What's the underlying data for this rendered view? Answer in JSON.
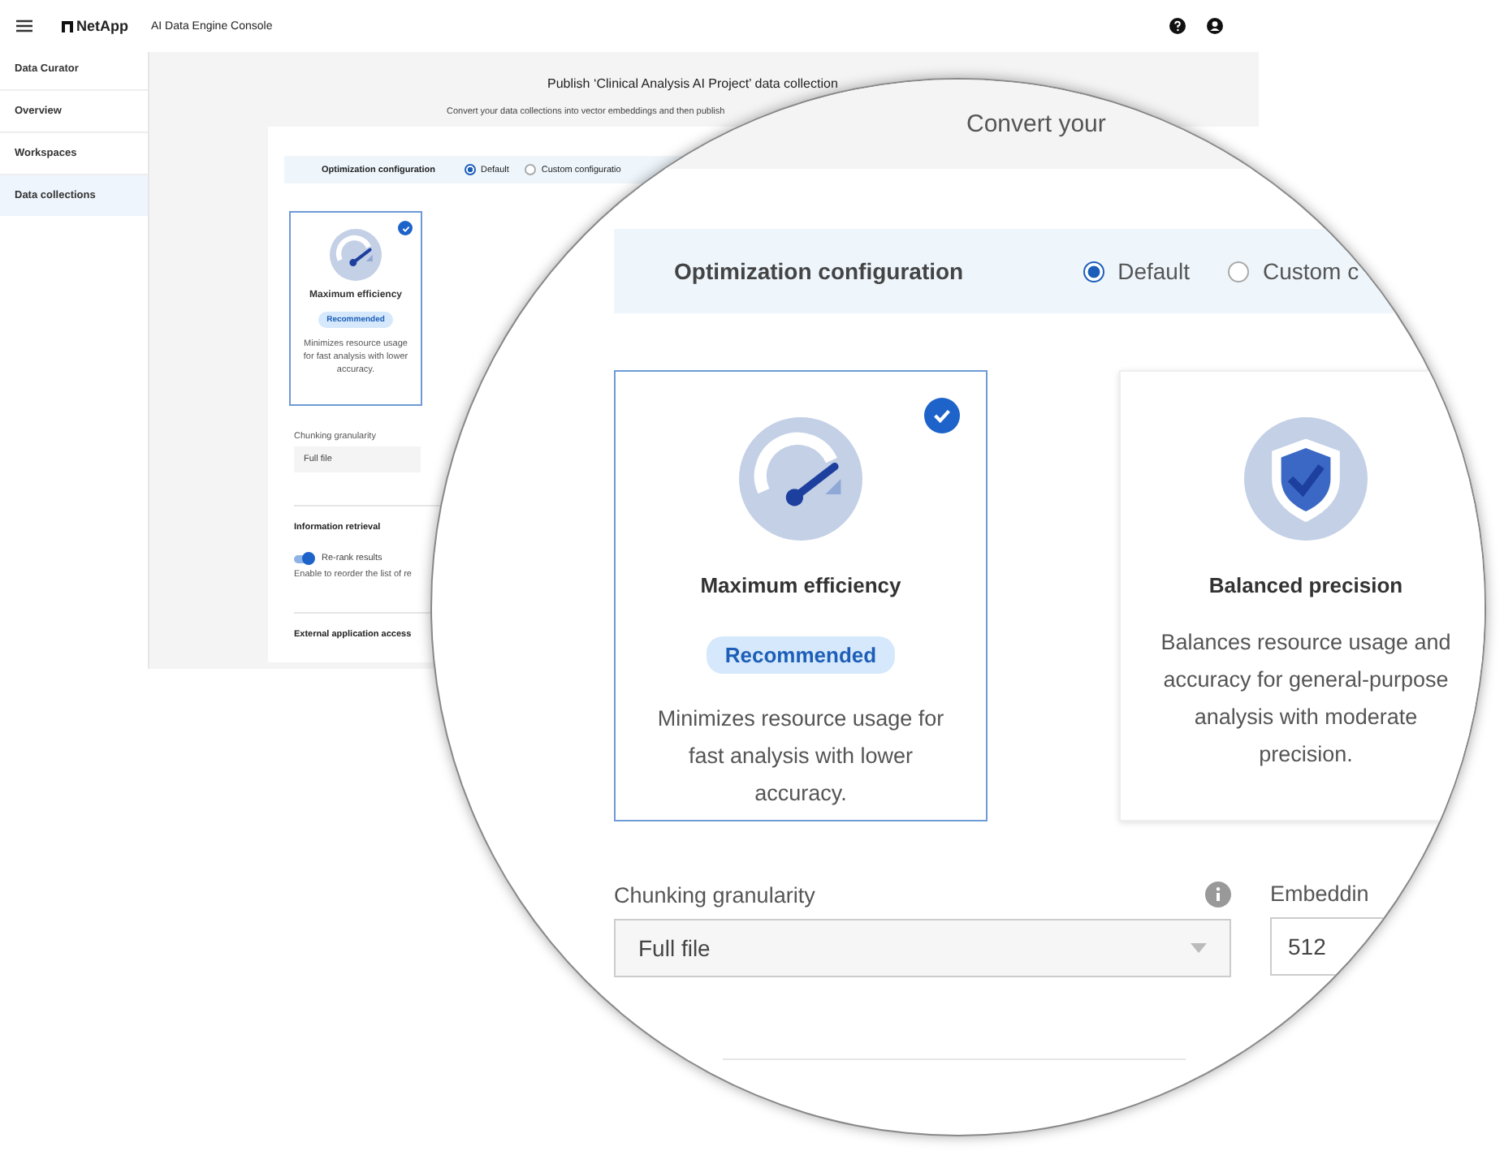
{
  "header": {
    "brand": "NetApp",
    "title": "AI Data Engine Console"
  },
  "sidebar": {
    "section": "Data Curator",
    "items": [
      {
        "label": "Overview",
        "selected": false
      },
      {
        "label": "Workspaces",
        "selected": false
      },
      {
        "label": "Data collections",
        "selected": true
      }
    ]
  },
  "page": {
    "title": "Publish ‘Clinical Analysis AI Project’ data collection",
    "subtitle": "Convert your data collections into vector embeddings and then publish",
    "optimization": {
      "label": "Optimization configuration",
      "options": [
        {
          "label": "Default",
          "selected": true
        },
        {
          "label": "Custom configuratio",
          "selected": false
        }
      ]
    },
    "cards": [
      {
        "kind": "gauge",
        "title": "Maximum efficiency",
        "badge": "Recommended",
        "description": "Minimizes resource usage for fast analysis with lower accuracy.",
        "selected": true
      }
    ],
    "chunking": {
      "label": "Chunking granularity",
      "value": "Full file"
    },
    "retrieval": {
      "heading": "Information retrieval",
      "toggle": {
        "label": "Re-rank results",
        "on": true
      },
      "hint": "Enable to reorder the list of re"
    },
    "external_heading": "External application access"
  },
  "magnifier": {
    "heading": "Convert your",
    "optimization": {
      "label": "Optimization configuration",
      "options": [
        {
          "label": "Default",
          "selected": true
        },
        {
          "label": "Custom c",
          "selected": false
        }
      ]
    },
    "cards": [
      {
        "kind": "gauge",
        "title": "Maximum efficiency",
        "badge": "Recommended",
        "description": "Minimizes resource usage for fast analysis with lower accuracy.",
        "selected": true
      },
      {
        "kind": "shield",
        "title": "Balanced precision",
        "description": "Balances resource usage and accuracy for general-purpose analysis with moderate precision.",
        "selected": false
      }
    ],
    "chunking": {
      "label": "Chunking granularity",
      "value": "Full file"
    },
    "embedding": {
      "label": "Embeddin",
      "value": "512"
    }
  }
}
